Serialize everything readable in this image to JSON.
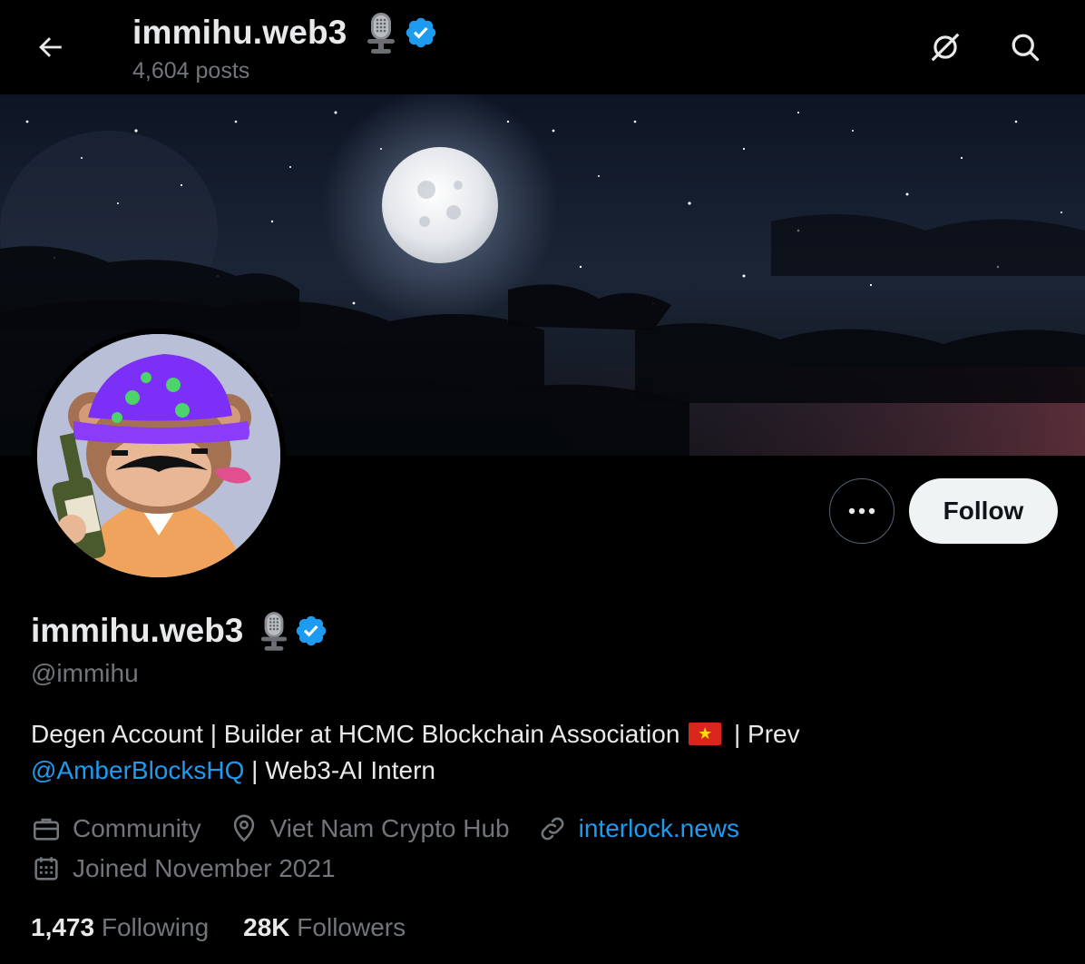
{
  "header": {
    "display_name": "immihu.web3",
    "posts_count": "4,604 posts"
  },
  "profile": {
    "display_name": "immihu.web3",
    "handle": "@immihu",
    "bio": {
      "part1": "Degen Account | Builder at HCMC Blockchain Association ",
      "flag_symbol": "★",
      "part2": " | Prev",
      "mention": "@AmberBlocksHQ",
      "part3": " | Web3-AI Intern"
    },
    "category": "Community",
    "location": "Viet Nam Crypto Hub",
    "website": "interlock.news",
    "joined": "Joined November 2021",
    "following_count": "1,473",
    "following_label": "Following",
    "followers_count": "28K",
    "followers_label": "Followers"
  },
  "actions": {
    "follow_label": "Follow"
  },
  "icons": {
    "back": "arrow-left-icon",
    "grok": "grok-icon",
    "search": "search-icon",
    "more": "more-dots-icon",
    "verified": "verified-badge-icon",
    "affiliate": "microphone-icon",
    "category": "briefcase-icon",
    "location": "location-pin-icon",
    "link": "link-icon",
    "calendar": "calendar-icon"
  },
  "colors": {
    "background": "#000000",
    "accent": "#1d9bf0",
    "text_primary": "#e7e9ea",
    "text_secondary": "#71767b",
    "follow_button_bg": "#eff3f4"
  }
}
